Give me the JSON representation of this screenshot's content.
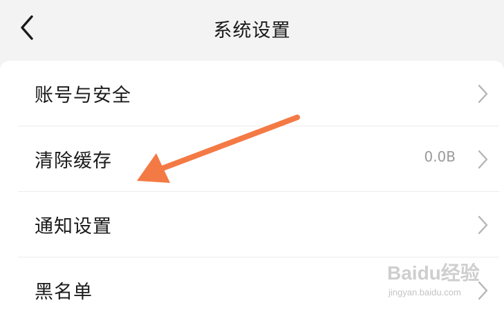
{
  "header": {
    "title": "系统设置",
    "back_icon": "chevron-left-icon"
  },
  "settings": {
    "items": [
      {
        "label": "账号与安全",
        "value": "",
        "icon": "chevron-right-icon"
      },
      {
        "label": "清除缓存",
        "value": "0.0B",
        "icon": "chevron-right-icon"
      },
      {
        "label": "通知设置",
        "value": "",
        "icon": "chevron-right-icon"
      },
      {
        "label": "黑名单",
        "value": "",
        "icon": "chevron-right-icon"
      }
    ]
  },
  "annotation": {
    "arrow_color": "#f47a45",
    "arrow_icon": "arrow-pointer-icon"
  },
  "watermark": {
    "text": "Baidu经验",
    "url": "jingyan.baidu.com"
  },
  "colors": {
    "header_bg": "#f3f3f3",
    "card_bg": "#ffffff",
    "text": "#1a1a1a",
    "secondary_text": "#9a9a9a",
    "chevron": "#b5b5b5"
  }
}
